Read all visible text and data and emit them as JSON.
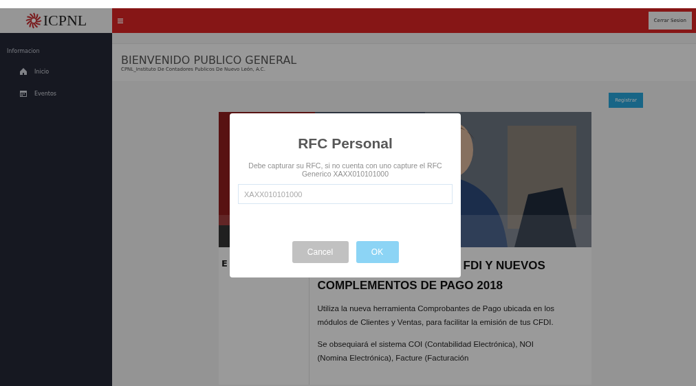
{
  "logo": {
    "text": "ICPNL"
  },
  "top_bar": {
    "logout_button": "Cerrar Sesion"
  },
  "sidebar": {
    "section": "Informacion",
    "items": [
      {
        "label": "Inicio"
      },
      {
        "label": "Eventos"
      }
    ]
  },
  "header": {
    "title": "BIENVENIDO PUBLICO GENERAL",
    "subtitle": "CPNL_Instituto De Contadores Publicos De Nuevo León, A.C."
  },
  "register_button": "Registrar",
  "article": {
    "side_text": "E",
    "heading": [
      "FDI Y NUEVOS",
      "COMPLEMENTOS DE PAGO 2018"
    ],
    "paragraphs": [
      "Utiliza la nueva herramienta Comprobantes de Pago ubicada en los módulos de Clientes y Ventas, para facilitar la emisión de tus CFDI.",
      "Se obsequiará el sistema COI (Contabilidad Electrónica), NOI (Nomina Electrónica), Facture (Facturación"
    ]
  },
  "modal": {
    "title": "RFC Personal",
    "message": "Debe capturar su RFC, si no cuenta con uno capture el RFC Generico XAXX010101000",
    "placeholder": "XAXX010101000",
    "buttons": [
      {
        "label": "Cancel",
        "kind": "cancel"
      },
      {
        "label": "OK",
        "kind": "confirm"
      }
    ]
  }
}
